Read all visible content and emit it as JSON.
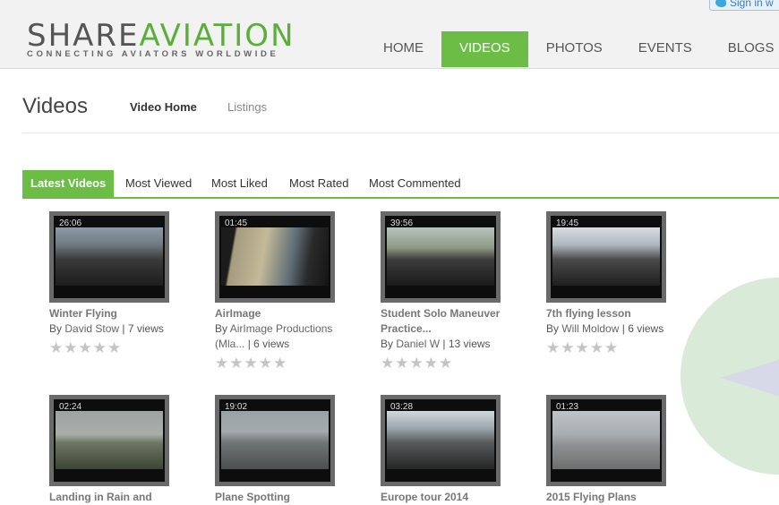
{
  "header": {
    "logo_part1": "SHARE",
    "logo_part2": "AVIATION",
    "tagline": "CONNECTING AVIATORS WORLDWIDE",
    "signin_label": "Sign in w",
    "nav": [
      {
        "label": "HOME"
      },
      {
        "label": "VIDEOS",
        "active": true
      },
      {
        "label": "PHOTOS"
      },
      {
        "label": "EVENTS"
      },
      {
        "label": "BLOGS"
      }
    ]
  },
  "page": {
    "title": "Videos",
    "subnav": {
      "home": "Video Home",
      "listings": "Listings"
    }
  },
  "tabs": [
    "Latest Videos",
    "Most Viewed",
    "Most Liked",
    "Most Rated",
    "Most Commented"
  ],
  "colors": {
    "accent": "#6cbd45",
    "thumb_frame": "#6a6a6a",
    "star_empty": "#c4c4c4"
  },
  "videos": [
    {
      "duration": "26:06",
      "title": "Winter Flying",
      "author": "David Stow",
      "views": "7 views",
      "rating": 0
    },
    {
      "duration": "01:45",
      "title": "AirImage",
      "author": "AirImage Productions (Mla...",
      "views": "6 views",
      "rating": 0
    },
    {
      "duration": "39:56",
      "title": "Student Solo Maneuver Practice...",
      "author": "Daniel W",
      "views": "13 views",
      "rating": 0
    },
    {
      "duration": "19:45",
      "title": "7th flying lesson",
      "author": "Will Moldow",
      "views": "6 views",
      "rating": 0
    },
    {
      "duration": "02:24",
      "title": "Landing in Rain and"
    },
    {
      "duration": "19:02",
      "title": "Plane Spotting"
    },
    {
      "duration": "03:28",
      "title": "Europe tour 2014"
    },
    {
      "duration": "01:23",
      "title": "2015 Flying Plans"
    }
  ],
  "labels": {
    "by": "By",
    "sep": "|"
  }
}
